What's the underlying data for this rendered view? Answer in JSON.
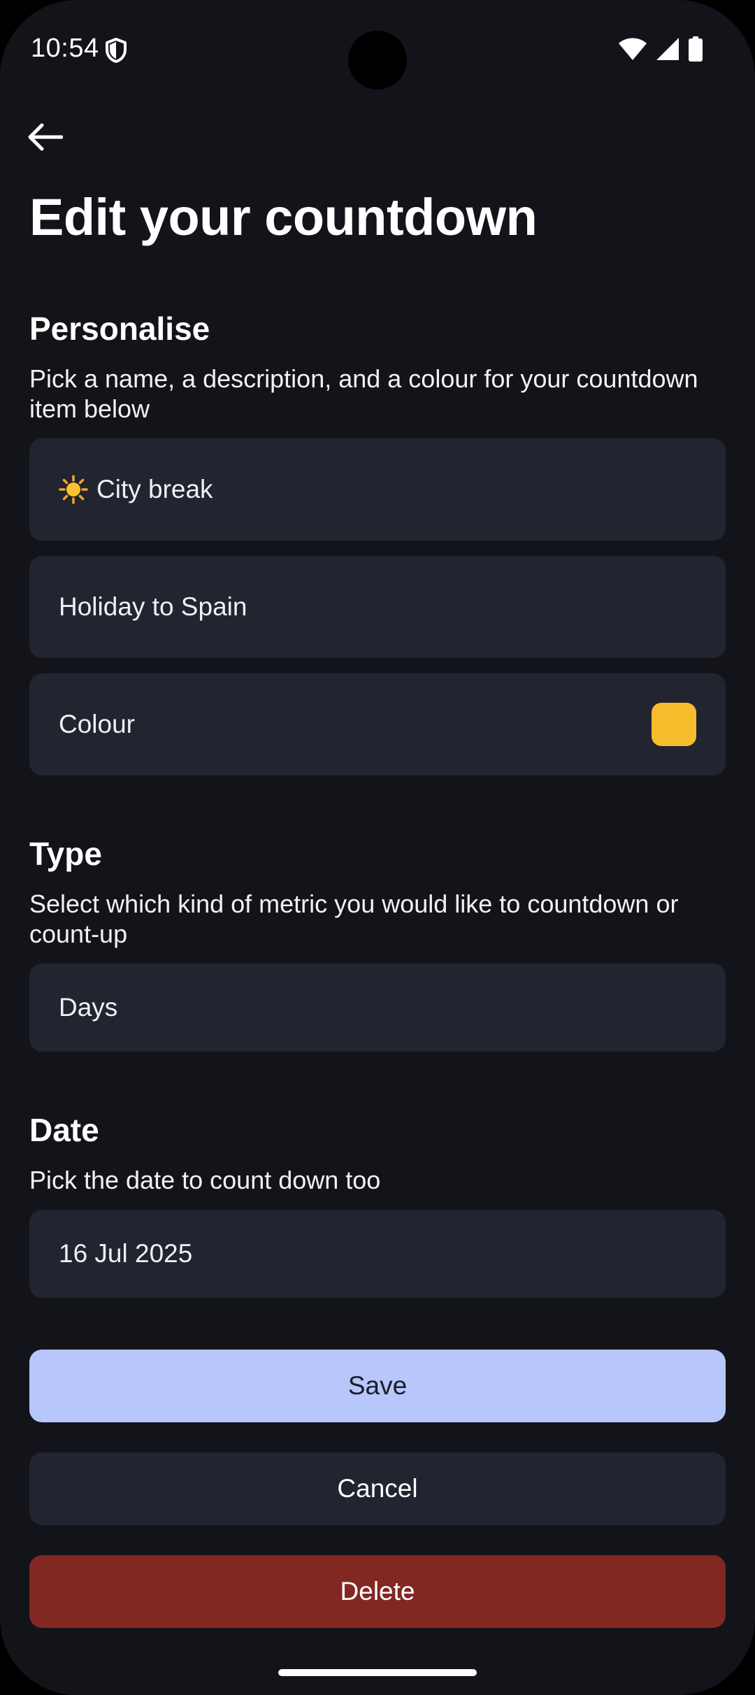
{
  "status_bar": {
    "time": "10:54"
  },
  "page": {
    "title": "Edit your countdown"
  },
  "personalise": {
    "title": "Personalise",
    "description": "Pick a name, a description, and a colour for your countdown item below",
    "name_value": "City break",
    "name_emoji": "sun-emoji",
    "description_value": "Holiday to Spain",
    "colour_label": "Colour",
    "colour_value": "#F6BC2C"
  },
  "type": {
    "title": "Type",
    "description": "Select which kind of metric you would like to countdown or count-up",
    "selected": "Days"
  },
  "date": {
    "title": "Date",
    "description": "Pick the date to count down too",
    "value": "16 Jul 2025"
  },
  "actions": {
    "save": "Save",
    "cancel": "Cancel",
    "delete": "Delete"
  },
  "colors": {
    "background": "#131419",
    "field": "#22242F",
    "save": "#B8C7FB",
    "delete": "#832723"
  }
}
